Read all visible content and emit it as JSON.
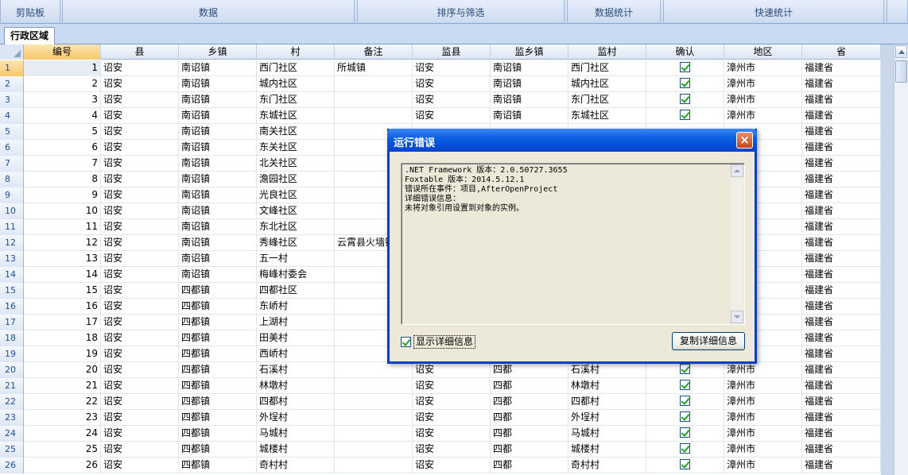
{
  "ribbon": {
    "groups": [
      "剪贴板",
      "数据",
      "排序与筛选",
      "数据统计",
      "快速统计"
    ]
  },
  "tabs": [
    {
      "label": "行政区域"
    }
  ],
  "table": {
    "columns": [
      "编号",
      "县",
      "乡镇",
      "村",
      "备注",
      "监县",
      "监乡镇",
      "监村",
      "确认",
      "地区",
      "省"
    ],
    "rows": [
      {
        "n": "1",
        "id": "1",
        "county": "诏安",
        "town": "南诏镇",
        "village": "西门社区",
        "note": "所城镇",
        "mcounty": "诏安",
        "mtown": "南诏镇",
        "mvillage": "西门社区",
        "region": "漳州市",
        "province": "福建省"
      },
      {
        "n": "2",
        "id": "2",
        "county": "诏安",
        "town": "南诏镇",
        "village": "城内社区",
        "note": "",
        "mcounty": "诏安",
        "mtown": "南诏镇",
        "mvillage": "城内社区",
        "region": "漳州市",
        "province": "福建省"
      },
      {
        "n": "3",
        "id": "3",
        "county": "诏安",
        "town": "南诏镇",
        "village": "东门社区",
        "note": "",
        "mcounty": "诏安",
        "mtown": "南诏镇",
        "mvillage": "东门社区",
        "region": "漳州市",
        "province": "福建省"
      },
      {
        "n": "4",
        "id": "4",
        "county": "诏安",
        "town": "南诏镇",
        "village": "东城社区",
        "note": "",
        "mcounty": "诏安",
        "mtown": "南诏镇",
        "mvillage": "东城社区",
        "region": "漳州市",
        "province": "福建省"
      },
      {
        "n": "5",
        "id": "5",
        "county": "诏安",
        "town": "南诏镇",
        "village": "南关社区",
        "note": "",
        "mcounty": "",
        "mtown": "",
        "mvillage": "",
        "region": "",
        "province": "福建省"
      },
      {
        "n": "6",
        "id": "6",
        "county": "诏安",
        "town": "南诏镇",
        "village": "东关社区",
        "note": "",
        "mcounty": "",
        "mtown": "",
        "mvillage": "",
        "region": "",
        "province": "福建省"
      },
      {
        "n": "7",
        "id": "7",
        "county": "诏安",
        "town": "南诏镇",
        "village": "北关社区",
        "note": "",
        "mcounty": "",
        "mtown": "",
        "mvillage": "",
        "region": "",
        "province": "福建省"
      },
      {
        "n": "8",
        "id": "8",
        "county": "诏安",
        "town": "南诏镇",
        "village": "澹园社区",
        "note": "",
        "mcounty": "",
        "mtown": "",
        "mvillage": "",
        "region": "",
        "province": "福建省"
      },
      {
        "n": "9",
        "id": "9",
        "county": "诏安",
        "town": "南诏镇",
        "village": "光良社区",
        "note": "",
        "mcounty": "",
        "mtown": "",
        "mvillage": "",
        "region": "",
        "province": "福建省"
      },
      {
        "n": "10",
        "id": "10",
        "county": "诏安",
        "town": "南诏镇",
        "village": "文峰社区",
        "note": "",
        "mcounty": "",
        "mtown": "",
        "mvillage": "",
        "region": "",
        "province": "福建省"
      },
      {
        "n": "11",
        "id": "11",
        "county": "诏安",
        "town": "南诏镇",
        "village": "东北社区",
        "note": "",
        "mcounty": "",
        "mtown": "",
        "mvillage": "",
        "region": "",
        "province": "福建省"
      },
      {
        "n": "12",
        "id": "12",
        "county": "诏安",
        "town": "南诏镇",
        "village": "秀峰社区",
        "note": "云霄县火墙镇",
        "mcounty": "",
        "mtown": "",
        "mvillage": "",
        "region": "",
        "province": "福建省"
      },
      {
        "n": "13",
        "id": "13",
        "county": "诏安",
        "town": "南诏镇",
        "village": "五一村",
        "note": "",
        "mcounty": "",
        "mtown": "",
        "mvillage": "",
        "region": "",
        "province": "福建省"
      },
      {
        "n": "14",
        "id": "14",
        "county": "诏安",
        "town": "南诏镇",
        "village": "梅峰村委会",
        "note": "",
        "mcounty": "",
        "mtown": "",
        "mvillage": "",
        "region": "",
        "province": "福建省"
      },
      {
        "n": "15",
        "id": "15",
        "county": "诏安",
        "town": "四都镇",
        "village": "四都社区",
        "note": "",
        "mcounty": "",
        "mtown": "",
        "mvillage": "",
        "region": "",
        "province": "福建省"
      },
      {
        "n": "16",
        "id": "16",
        "county": "诏安",
        "town": "四都镇",
        "village": "东峤村",
        "note": "",
        "mcounty": "",
        "mtown": "",
        "mvillage": "",
        "region": "",
        "province": "福建省"
      },
      {
        "n": "17",
        "id": "17",
        "county": "诏安",
        "town": "四都镇",
        "village": "上湖村",
        "note": "",
        "mcounty": "",
        "mtown": "",
        "mvillage": "",
        "region": "",
        "province": "福建省"
      },
      {
        "n": "18",
        "id": "18",
        "county": "诏安",
        "town": "四都镇",
        "village": "田美村",
        "note": "",
        "mcounty": "",
        "mtown": "",
        "mvillage": "",
        "region": "",
        "province": "福建省"
      },
      {
        "n": "19",
        "id": "19",
        "county": "诏安",
        "town": "四都镇",
        "village": "西峤村",
        "note": "",
        "mcounty": "",
        "mtown": "",
        "mvillage": "",
        "region": "",
        "province": "福建省"
      },
      {
        "n": "20",
        "id": "20",
        "county": "诏安",
        "town": "四都镇",
        "village": "石溪村",
        "note": "",
        "mcounty": "诏安",
        "mtown": "四都",
        "mvillage": "石溪村",
        "region": "漳州市",
        "province": "福建省"
      },
      {
        "n": "21",
        "id": "21",
        "county": "诏安",
        "town": "四都镇",
        "village": "林墩村",
        "note": "",
        "mcounty": "诏安",
        "mtown": "四都",
        "mvillage": "林墩村",
        "region": "漳州市",
        "province": "福建省"
      },
      {
        "n": "22",
        "id": "22",
        "county": "诏安",
        "town": "四都镇",
        "village": "四都村",
        "note": "",
        "mcounty": "诏安",
        "mtown": "四都",
        "mvillage": "四都村",
        "region": "漳州市",
        "province": "福建省"
      },
      {
        "n": "23",
        "id": "23",
        "county": "诏安",
        "town": "四都镇",
        "village": "外埕村",
        "note": "",
        "mcounty": "诏安",
        "mtown": "四都",
        "mvillage": "外埕村",
        "region": "漳州市",
        "province": "福建省"
      },
      {
        "n": "24",
        "id": "24",
        "county": "诏安",
        "town": "四都镇",
        "village": "马城村",
        "note": "",
        "mcounty": "诏安",
        "mtown": "四都",
        "mvillage": "马城村",
        "region": "漳州市",
        "province": "福建省"
      },
      {
        "n": "25",
        "id": "25",
        "county": "诏安",
        "town": "四都镇",
        "village": "城楼村",
        "note": "",
        "mcounty": "诏安",
        "mtown": "四都",
        "mvillage": "城楼村",
        "region": "漳州市",
        "province": "福建省"
      },
      {
        "n": "26",
        "id": "26",
        "county": "诏安",
        "town": "四都镇",
        "village": "奇村村",
        "note": "",
        "mcounty": "诏安",
        "mtown": "四都",
        "mvillage": "奇村村",
        "region": "漳州市",
        "province": "福建省"
      }
    ]
  },
  "dialog": {
    "title": "运行错误",
    "close_symbol": "×",
    "message_lines": [
      ".NET Framework 版本：2.0.50727.3655",
      "Foxtable 版本：2014.5.12.1",
      "错误所在事件：项目,AfterOpenProject",
      "详细错误信息：",
      "未将对象引用设置到对象的实例。"
    ],
    "show_details_label": "显示详细信息",
    "copy_button_label": "复制详细信息"
  },
  "colors": {
    "title_bar": "#0b5fe3",
    "header_bg": "#dbe5f3",
    "selected_header": "#f7c868",
    "check_color": "#21a121"
  }
}
